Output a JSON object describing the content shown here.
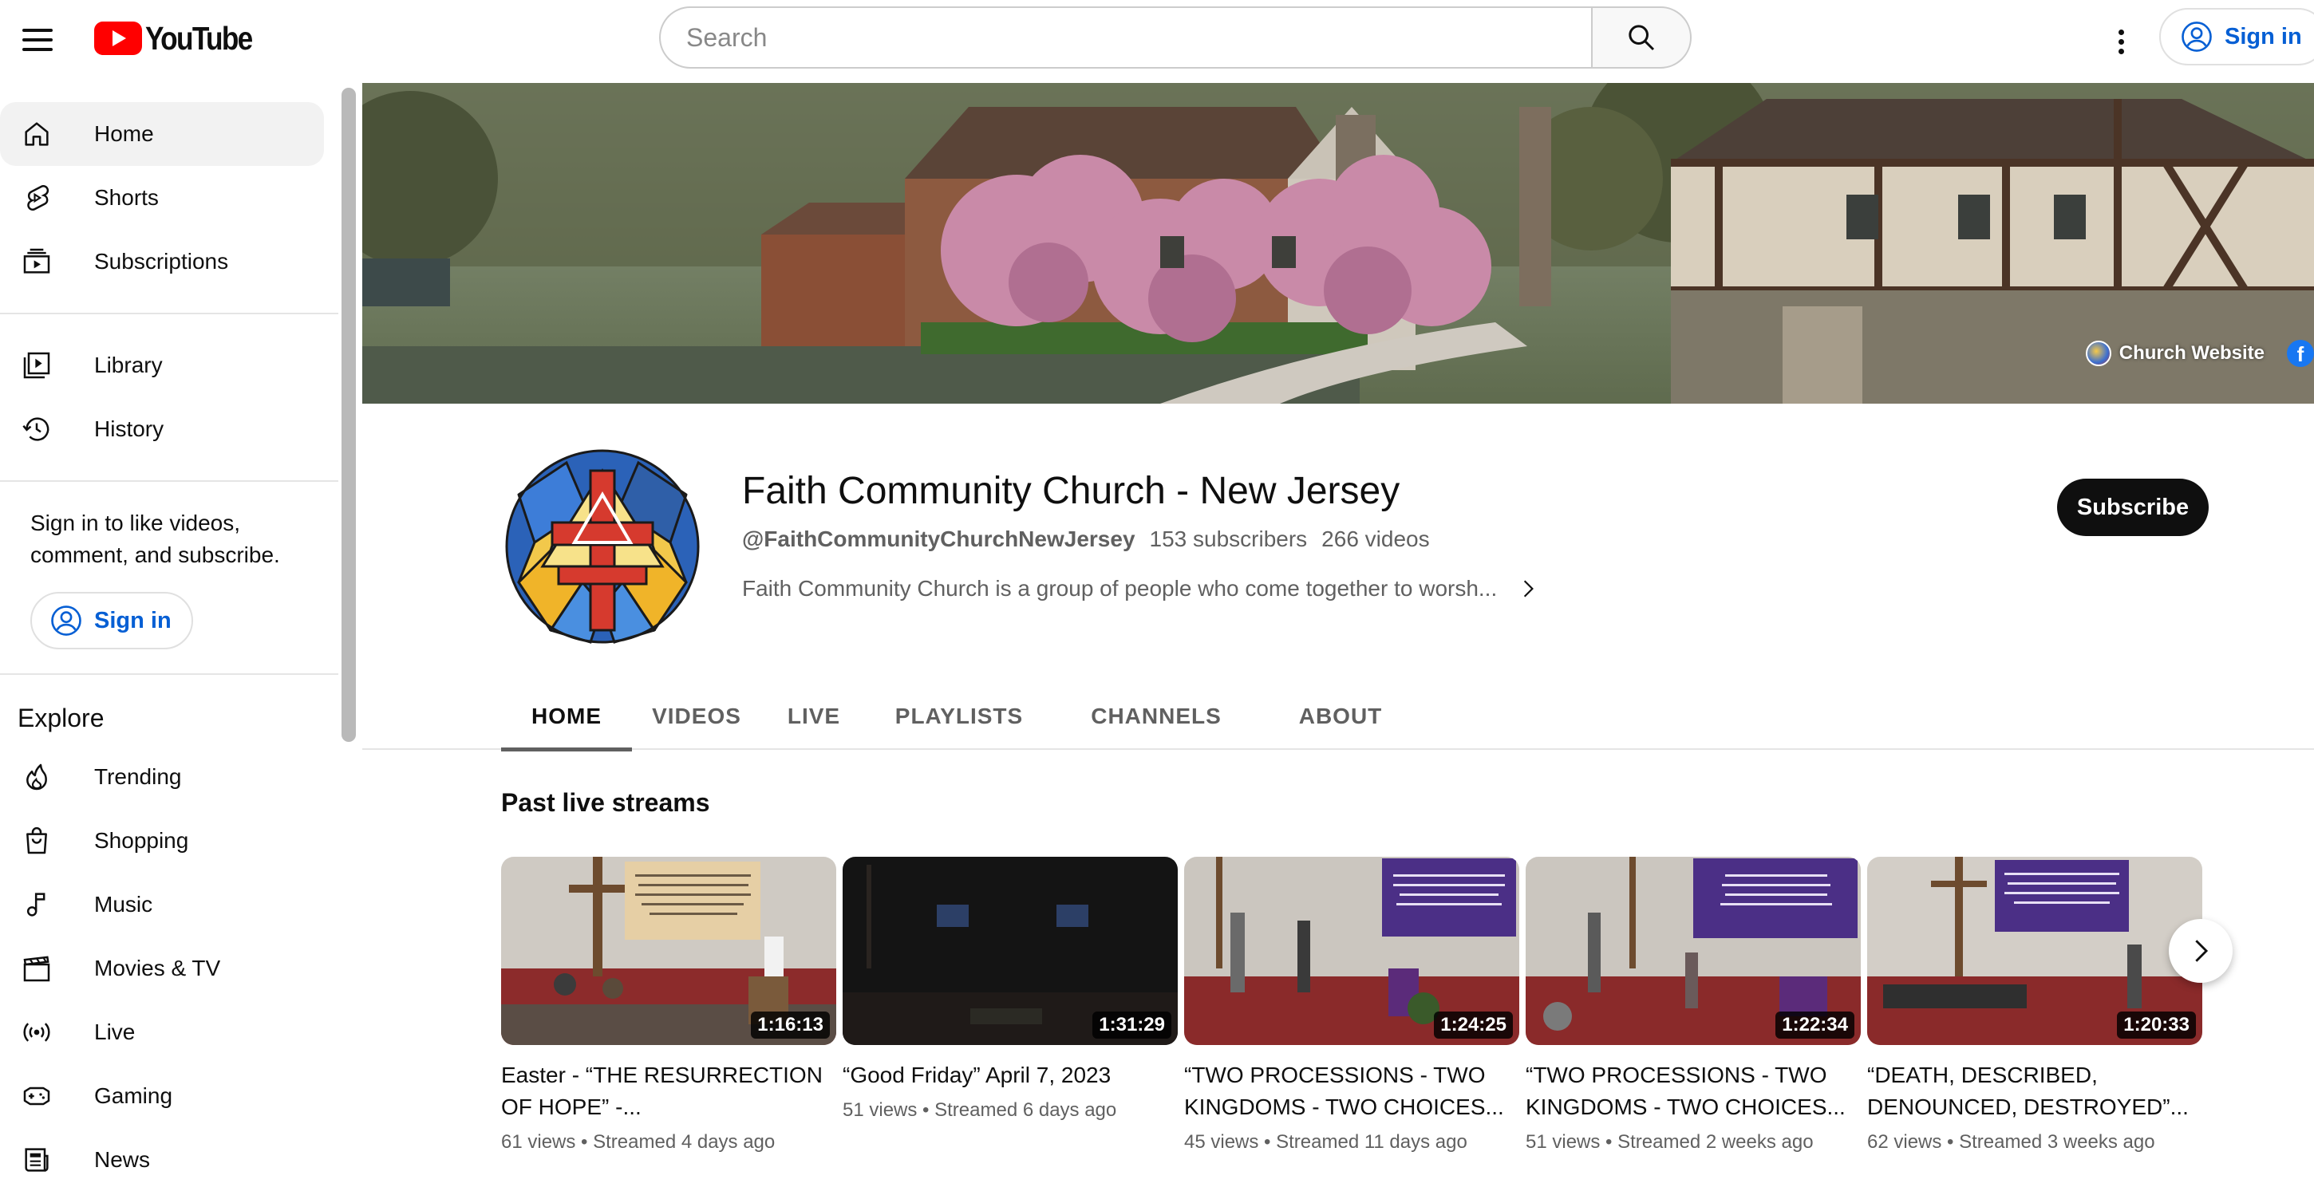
{
  "header": {
    "logo_text": "YouTube",
    "search_placeholder": "Search",
    "sign_in_label": "Sign in"
  },
  "sidebar": {
    "items": [
      {
        "label": "Home",
        "icon": "home-icon"
      },
      {
        "label": "Shorts",
        "icon": "shorts-icon"
      },
      {
        "label": "Subscriptions",
        "icon": "subscriptions-icon"
      },
      {
        "label": "Library",
        "icon": "library-icon"
      },
      {
        "label": "History",
        "icon": "history-icon"
      }
    ],
    "signin_prompt": "Sign in to like videos, comment, and subscribe.",
    "signin_label": "Sign in",
    "explore_title": "Explore",
    "explore_items": [
      {
        "label": "Trending",
        "icon": "trending-icon"
      },
      {
        "label": "Shopping",
        "icon": "shopping-icon"
      },
      {
        "label": "Music",
        "icon": "music-icon"
      },
      {
        "label": "Movies & TV",
        "icon": "movies-icon"
      },
      {
        "label": "Live",
        "icon": "live-icon"
      },
      {
        "label": "Gaming",
        "icon": "gaming-icon"
      },
      {
        "label": "News",
        "icon": "news-icon"
      }
    ]
  },
  "banner": {
    "website_link": "Church Website"
  },
  "channel": {
    "name": "Faith Community Church - New Jersey",
    "handle": "@FaithCommunityChurchNewJersey",
    "subscribers": "153 subscribers",
    "videos": "266 videos",
    "description": "Faith Community Church is a group of people who come together to worsh...",
    "subscribe_label": "Subscribe"
  },
  "tabs": [
    {
      "label": "HOME",
      "active": true
    },
    {
      "label": "VIDEOS",
      "active": false
    },
    {
      "label": "LIVE",
      "active": false
    },
    {
      "label": "PLAYLISTS",
      "active": false
    },
    {
      "label": "CHANNELS",
      "active": false
    },
    {
      "label": "ABOUT",
      "active": false
    }
  ],
  "section": {
    "title": "Past live streams",
    "videos": [
      {
        "title": "Easter - “THE RESURRECTION OF HOPE” -...",
        "duration": "1:16:13",
        "meta": "61 views • Streamed 4 days ago"
      },
      {
        "title": "“Good Friday” April 7, 2023",
        "duration": "1:31:29",
        "meta": "51 views • Streamed 6 days ago"
      },
      {
        "title": "“TWO PROCESSIONS - TWO KINGDOMS - TWO CHOICES...",
        "duration": "1:24:25",
        "meta": "45 views • Streamed 11 days ago"
      },
      {
        "title": "“TWO PROCESSIONS - TWO KINGDOMS - TWO CHOICES...",
        "duration": "1:22:34",
        "meta": "51 views • Streamed 2 weeks ago"
      },
      {
        "title": "“DEATH, DESCRIBED, DENOUNCED, DESTROYED”...",
        "duration": "1:20:33",
        "meta": "62 views • Streamed 3 weeks ago"
      }
    ]
  },
  "colors": {
    "brand_red": "#ff0000",
    "link_blue": "#065fd4",
    "text_primary": "#0f0f0f",
    "text_secondary": "#606060"
  }
}
